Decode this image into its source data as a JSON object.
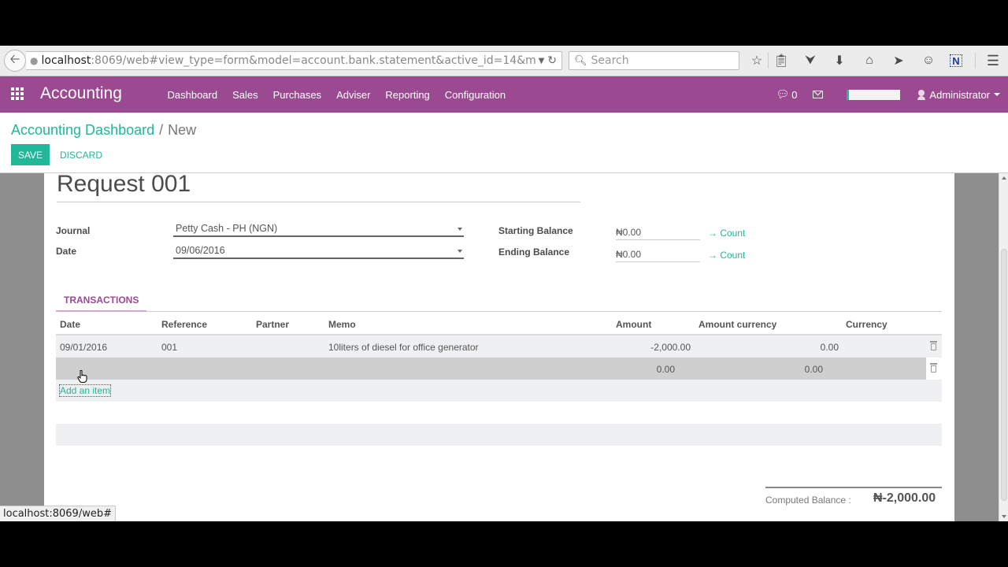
{
  "browser": {
    "url_host": "localhost",
    "url_rest": ":8069/web#view_type=form&model=account.bank.statement&active_id=14&menu_i",
    "search_placeholder": "Search",
    "status_url": "localhost:8069/web#",
    "toolbar_icons": [
      "star-icon",
      "reading-list-icon",
      "pocket-icon",
      "download-icon",
      "home-icon",
      "send-icon",
      "chat-icon",
      "extension-n-icon",
      "hamburger-menu-icon"
    ]
  },
  "navbar": {
    "app_title": "Accounting",
    "menu": [
      "Dashboard",
      "Sales",
      "Purchases",
      "Adviser",
      "Reporting",
      "Configuration"
    ],
    "chat_count": "0",
    "user": "Administrator",
    "brand_color": "#9b4a92"
  },
  "control_panel": {
    "breadcrumb_parent": "Accounting Dashboard",
    "breadcrumb_sep": "/",
    "breadcrumb_current": "New",
    "save_label": "SAVE",
    "discard_label": "DISCARD",
    "accent_color": "#21b799"
  },
  "form": {
    "title": "Request 001",
    "journal_label": "Journal",
    "journal_value": "Petty Cash - PH (NGN)",
    "date_label": "Date",
    "date_value": "09/06/2016",
    "starting_balance_label": "Starting Balance",
    "starting_balance_value": "₦0.00",
    "ending_balance_label": "Ending Balance",
    "ending_balance_value": "₦0.00",
    "count_label": "→ Count"
  },
  "transactions": {
    "tab_label": "TRANSACTIONS",
    "columns": [
      "Date",
      "Reference",
      "Partner",
      "Memo",
      "Amount",
      "Amount currency",
      "Currency"
    ],
    "rows": [
      {
        "date": "09/01/2016",
        "reference": "001",
        "partner": "",
        "memo": "10liters of diesel for office generator",
        "amount": "-2,000.00",
        "amount_currency": "0.00",
        "currency": ""
      },
      {
        "date": "",
        "reference": "",
        "partner": "",
        "memo": "",
        "amount": "0.00",
        "amount_currency": "0.00",
        "currency": ""
      }
    ],
    "add_item_label": "Add an item"
  },
  "footer": {
    "computed_balance_label": "Computed Balance :",
    "computed_balance_value": "₦-2,000.00"
  }
}
